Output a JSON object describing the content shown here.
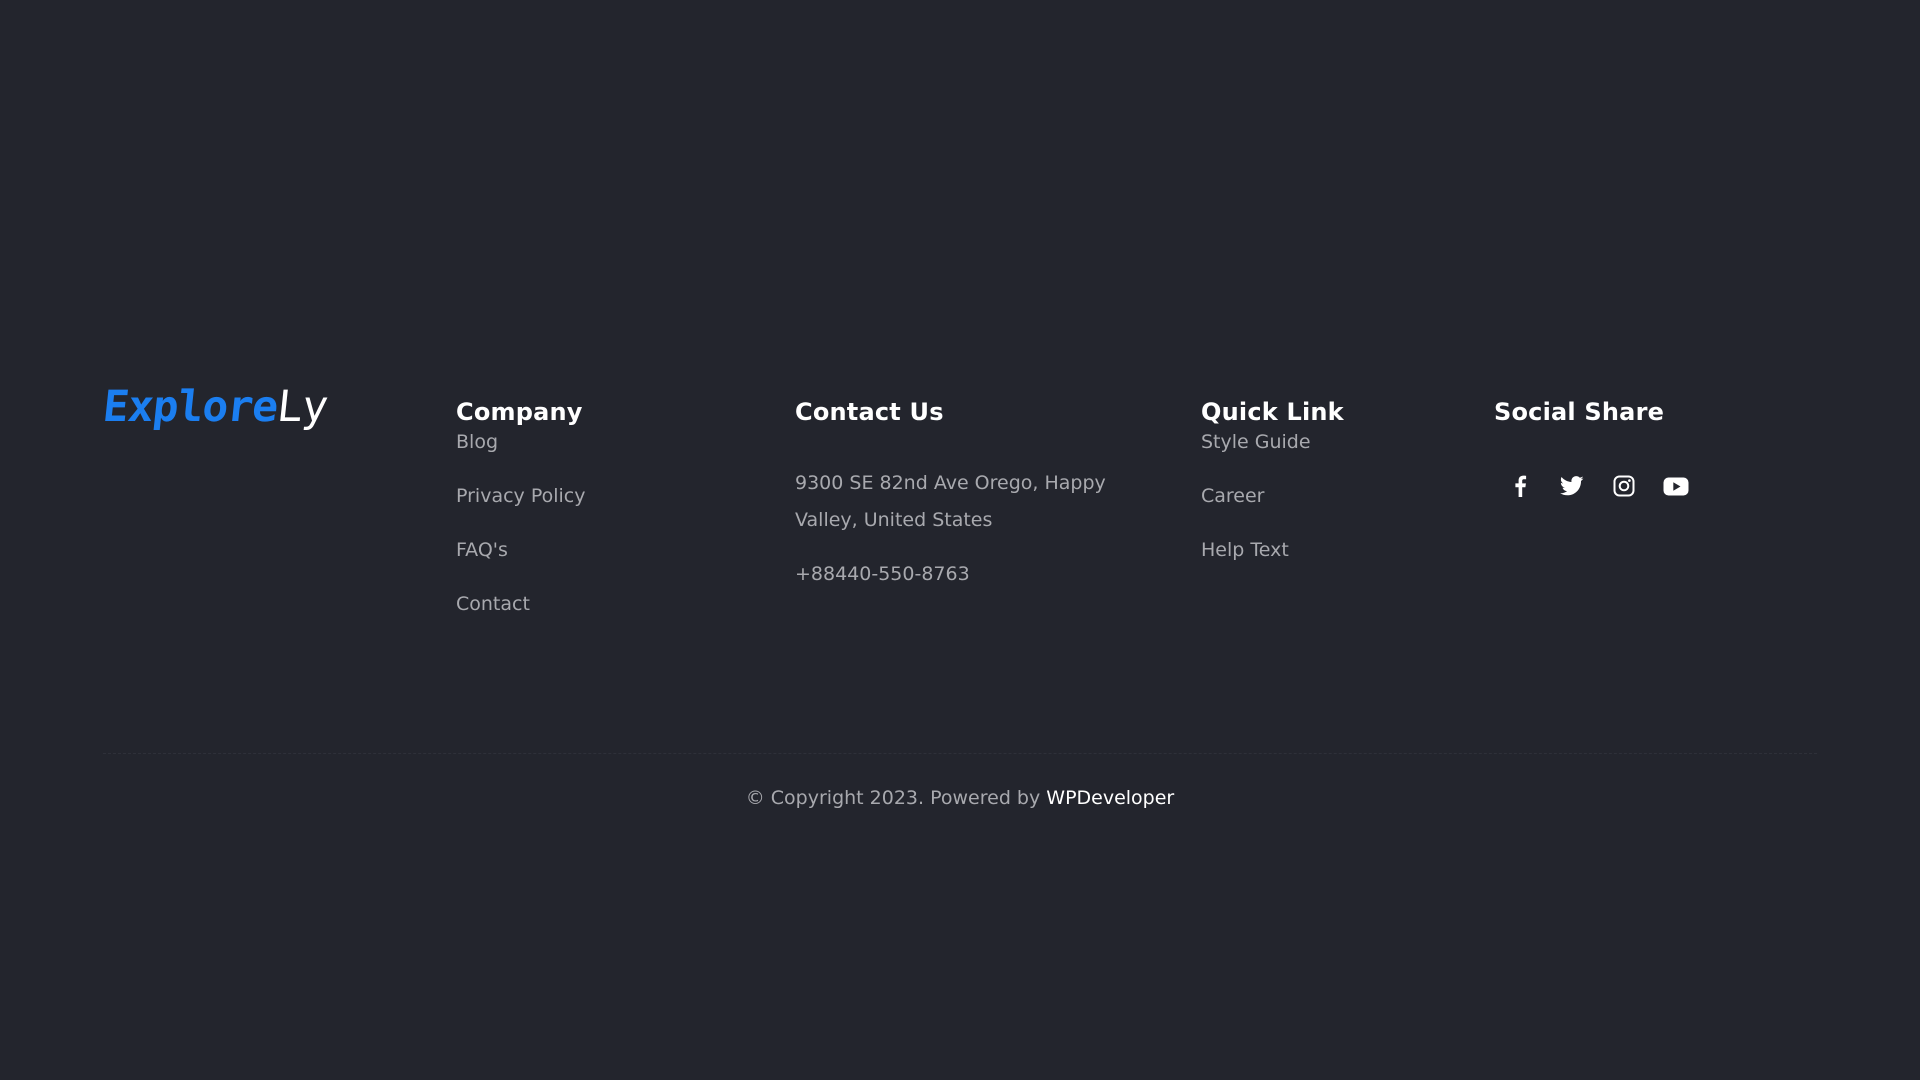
{
  "brand": {
    "logo_part1": "Explore",
    "logo_part2": "Ly",
    "accent_color": "#1b7ef0"
  },
  "company": {
    "heading": "Company",
    "links": [
      "Blog",
      "Privacy Policy",
      "FAQ's",
      "Contact"
    ]
  },
  "contact": {
    "heading": "Contact Us",
    "address": "9300 SE 82nd Ave Orego, Happy Valley, United States",
    "phone": "+88440-550-8763"
  },
  "quick_link": {
    "heading": "Quick Link",
    "links": [
      "Style Guide",
      "Career",
      "Help Text"
    ]
  },
  "social": {
    "heading": "Social Share",
    "icons": [
      "facebook-icon",
      "twitter-icon",
      "instagram-icon",
      "youtube-icon"
    ]
  },
  "footer": {
    "copyright_text": "© Copyright 2023. Powered by",
    "powered_link": "WPDeveloper"
  },
  "colors": {
    "background": "#23252d",
    "text_muted": "#a8a9ae",
    "heading": "#ffffff"
  }
}
